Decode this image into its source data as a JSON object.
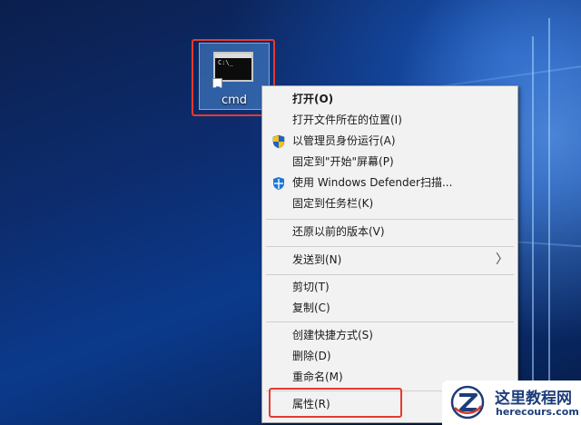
{
  "desktop": {
    "icon": {
      "label": "cmd",
      "console_text": "C:\\_"
    }
  },
  "context_menu": {
    "items": [
      {
        "label": "打开(O)",
        "bold": true,
        "icon": ""
      },
      {
        "label": "打开文件所在的位置(I)",
        "icon": ""
      },
      {
        "label": "以管理员身份运行(A)",
        "icon": "uac-shield-icon"
      },
      {
        "label": "固定到\"开始\"屏幕(P)",
        "icon": ""
      },
      {
        "label": "使用 Windows Defender扫描...",
        "icon": "windows-defender-icon"
      },
      {
        "label": "固定到任务栏(K)",
        "icon": ""
      },
      {
        "label": "还原以前的版本(V)",
        "icon": ""
      },
      {
        "label": "发送到(N)",
        "icon": "",
        "submenu": true
      },
      {
        "label": "剪切(T)",
        "icon": ""
      },
      {
        "label": "复制(C)",
        "icon": ""
      },
      {
        "label": "创建快捷方式(S)",
        "icon": ""
      },
      {
        "label": "删除(D)",
        "icon": ""
      },
      {
        "label": "重命名(M)",
        "icon": ""
      },
      {
        "label": "属性(R)",
        "icon": ""
      }
    ],
    "submenu_arrow": "〉"
  },
  "highlights": {
    "color": "#e53a2f"
  },
  "watermark": {
    "title": "这里教程网",
    "subtitle": "herecours.com"
  }
}
